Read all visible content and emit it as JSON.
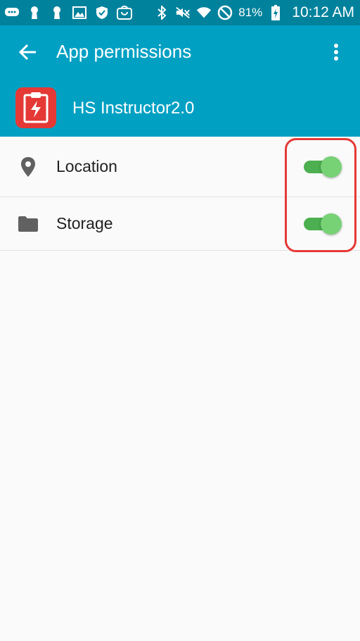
{
  "status_bar": {
    "battery": "81%",
    "time": "10:12 AM",
    "icons_left": [
      "chat-icon",
      "keyhole-icon",
      "keyhole-icon",
      "image-icon",
      "shield-icon",
      "bag-icon"
    ],
    "icons_right": [
      "bluetooth-icon",
      "mute-icon",
      "wifi-icon",
      "do-not-disturb-icon",
      "battery-charging-icon"
    ]
  },
  "app_bar": {
    "title": "App permissions",
    "app_name": "HS Instructor2.0",
    "color": "#00a0c3",
    "status_color": "#00829c"
  },
  "permissions": [
    {
      "label": "Location",
      "icon": "location-pin-icon",
      "enabled": true
    },
    {
      "label": "Storage",
      "icon": "folder-icon",
      "enabled": true
    }
  ],
  "colors": {
    "toggle_on": "#4caf50",
    "highlight": "#e53935"
  }
}
